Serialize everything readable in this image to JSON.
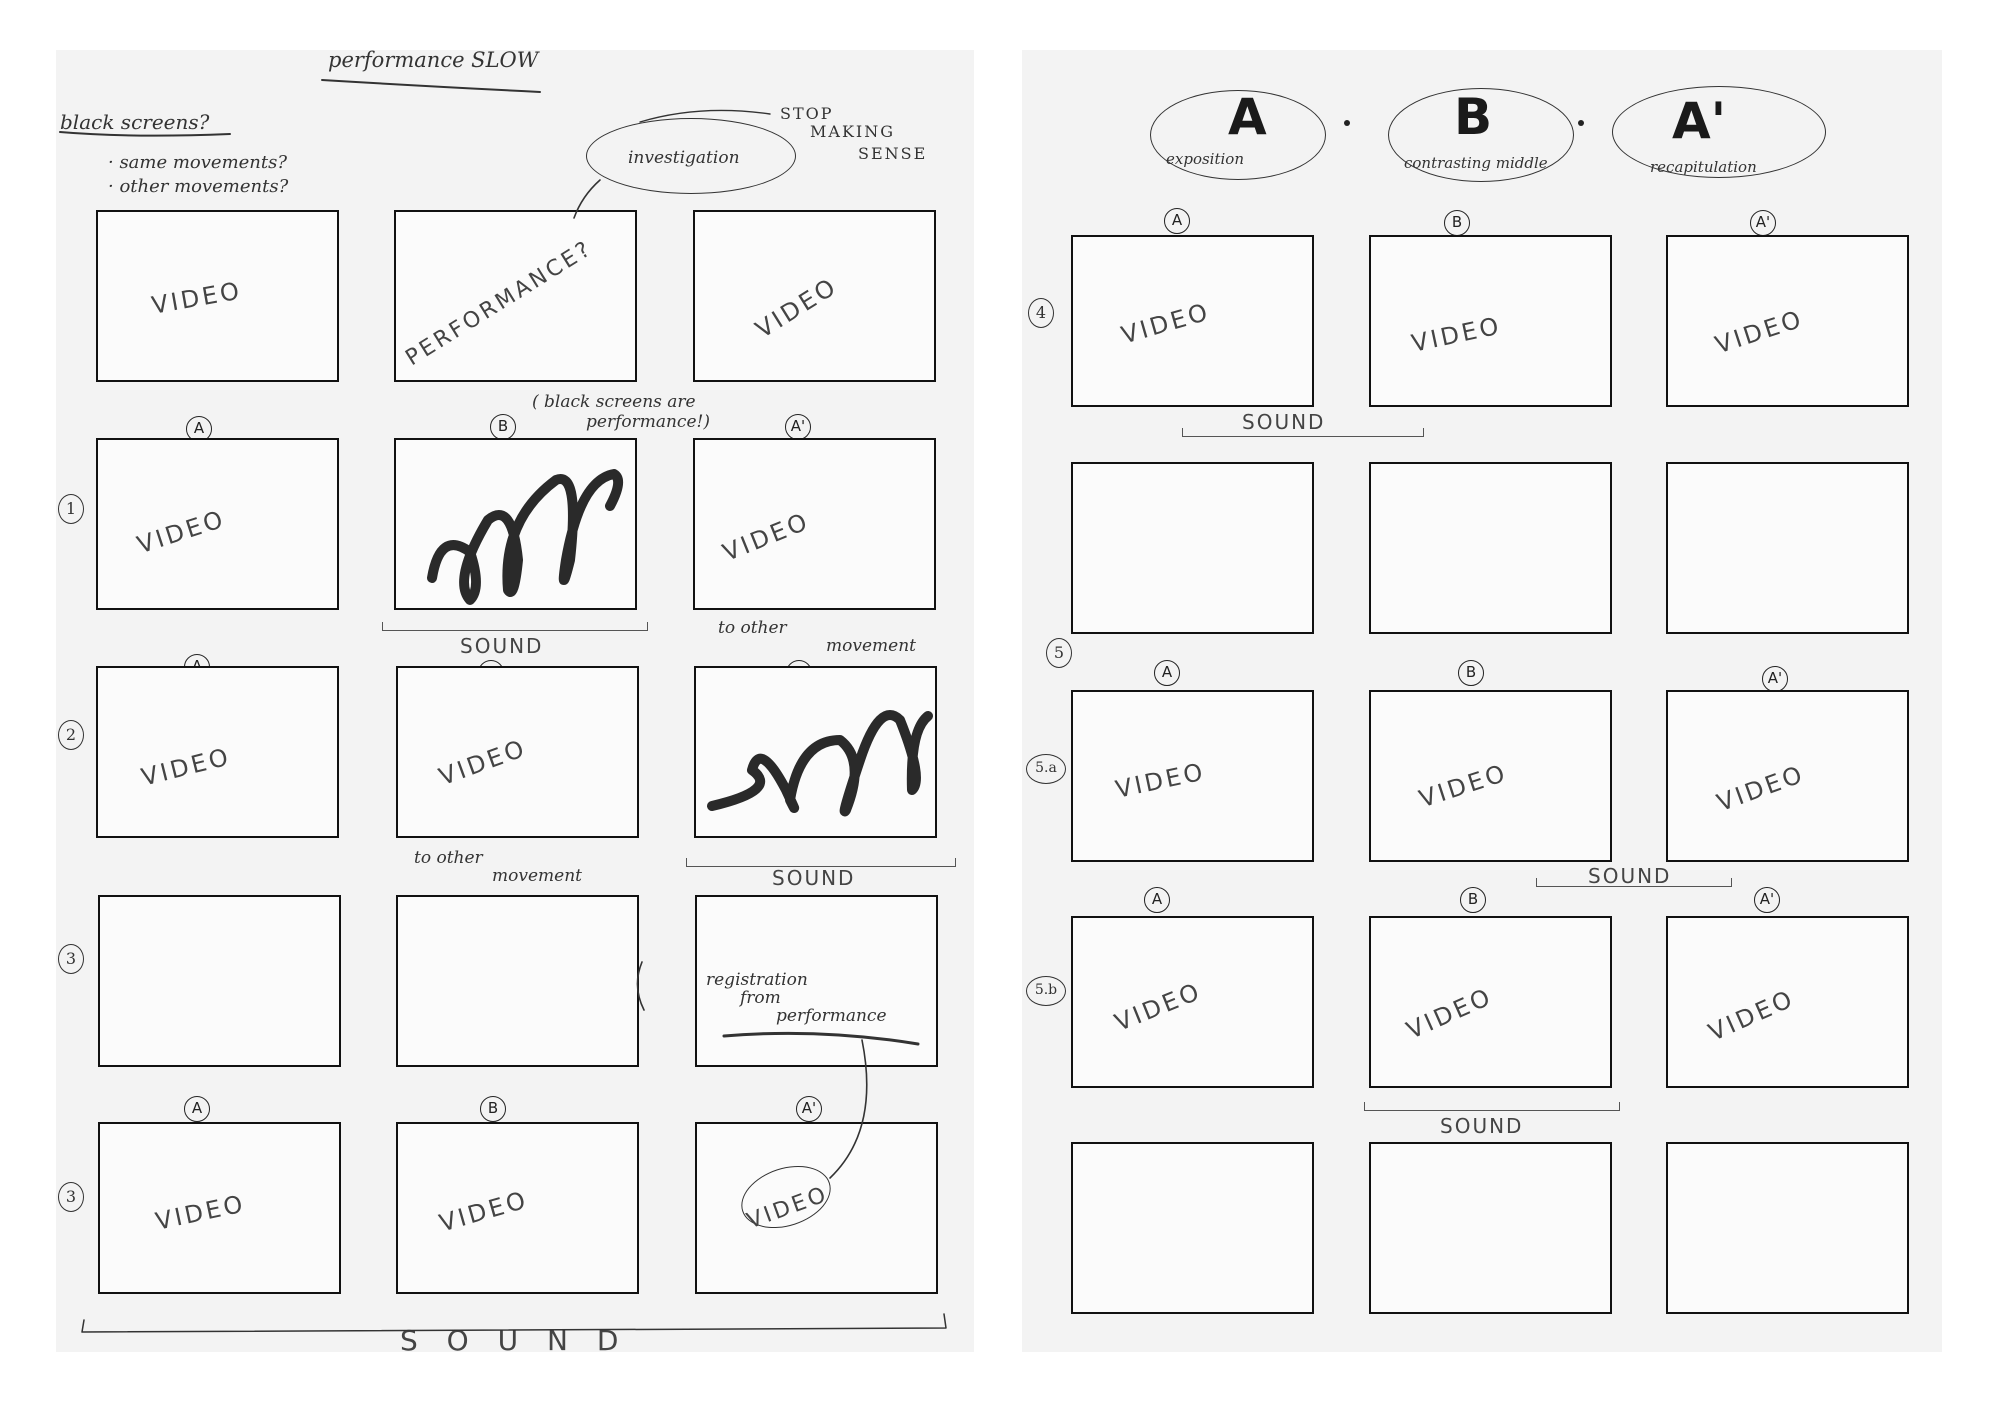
{
  "left_page": {
    "title": "performance SLOW",
    "questions": [
      "black screens?",
      "· same movements?",
      "· other movements?"
    ],
    "callout": {
      "label": "investigation",
      "note_lines": [
        "STOP",
        "MAKING",
        "SENSE"
      ]
    },
    "top_row": [
      "VIDEO",
      "PERFORMANCE?",
      "VIDEO"
    ],
    "note_black_screens": [
      "( black screens are",
      "performance!)"
    ],
    "rows": [
      {
        "number": "1",
        "markers": [
          "A",
          "B",
          "A'"
        ],
        "cells": [
          "VIDEO",
          "",
          "VIDEO"
        ],
        "sound": "SOUND",
        "note": [
          "to other",
          "movement"
        ]
      },
      {
        "number": "2",
        "markers": [
          "A",
          "B",
          "A'"
        ],
        "cells": [
          "VIDEO",
          "VIDEO",
          ""
        ],
        "sound": "SOUND",
        "note": [
          "to other",
          "movement"
        ]
      },
      {
        "number": "3",
        "cells": [
          "",
          "",
          ""
        ],
        "note": [
          "registration",
          "from",
          "performance"
        ]
      },
      {
        "number": "3",
        "markers": [
          "A",
          "B",
          "A'"
        ],
        "cells": [
          "VIDEO",
          "VIDEO",
          "VIDEO"
        ],
        "sound": "S O U N D"
      }
    ]
  },
  "right_page": {
    "header": [
      {
        "letter": "A",
        "label": "exposition"
      },
      {
        "letter": "B",
        "label": "contrasting middle"
      },
      {
        "letter": "A'",
        "label": "recapitulation"
      }
    ],
    "rows": [
      {
        "number": "4",
        "markers": [
          "A",
          "B",
          "A'"
        ],
        "cells": [
          "VIDEO",
          "VIDEO",
          "VIDEO"
        ],
        "sound": "SOUND"
      },
      {
        "number": "5",
        "cells": [
          "",
          "",
          ""
        ]
      },
      {
        "number": "5.a",
        "markers": [
          "A",
          "B",
          "A'"
        ],
        "cells": [
          "VIDEO",
          "VIDEO",
          "VIDEO"
        ],
        "sound": "SOUND"
      },
      {
        "number": "5.b",
        "markers": [
          "A",
          "B",
          "A'"
        ],
        "cells": [
          "VIDEO",
          "VIDEO",
          "VIDEO"
        ],
        "sound": "SOUND"
      },
      {
        "number": "",
        "cells": [
          "",
          "",
          ""
        ]
      }
    ]
  }
}
